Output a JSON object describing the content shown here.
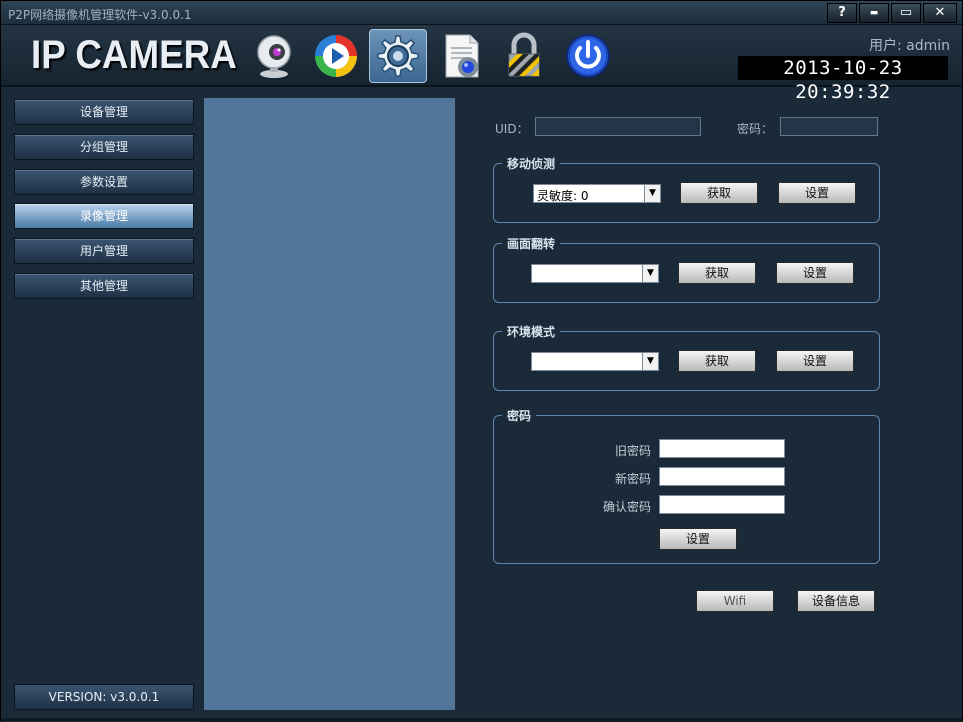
{
  "window": {
    "title": "P2P网络摄像机管理软件-v3.0.0.1",
    "controls": [
      "?",
      "▬",
      "▭",
      "✕"
    ]
  },
  "header": {
    "logo": "IP CAMERA",
    "user": "用户: admin",
    "datetime": "2013-10-23 20:39:32",
    "toolbar": [
      {
        "icon": "webcam-icon"
      },
      {
        "icon": "play-icon"
      },
      {
        "icon": "settings-gear-icon",
        "active": true
      },
      {
        "icon": "document-settings-icon"
      },
      {
        "icon": "lock-icon"
      },
      {
        "icon": "power-icon"
      }
    ]
  },
  "sidebar": {
    "items": [
      {
        "label": "设备管理"
      },
      {
        "label": "分组管理"
      },
      {
        "label": "参数设置"
      },
      {
        "label": "录像管理",
        "selected": true
      },
      {
        "label": "用户管理"
      },
      {
        "label": "其他管理"
      }
    ],
    "version": "VERSION: v3.0.0.1"
  },
  "form": {
    "uid_label": "UID：",
    "uid_value": "",
    "password_label": "密码：",
    "password_value": "",
    "motion": {
      "title": "移动侦测",
      "selected": "灵敏度: 0",
      "get_label": "获取",
      "set_label": "设置"
    },
    "flip": {
      "title": "画面翻转",
      "selected": "",
      "get_label": "获取",
      "set_label": "设置"
    },
    "env": {
      "title": "环境模式",
      "selected": "",
      "get_label": "获取",
      "set_label": "设置"
    },
    "pwd": {
      "title": "密码",
      "old_label": "旧密码",
      "new_label": "新密码",
      "confirm_label": "确认密码",
      "old_value": "",
      "new_value": "",
      "confirm_value": "",
      "set_label": "设置"
    },
    "wifi_label": "Wifi",
    "devinfo_label": "设备信息"
  },
  "colors": {
    "background": "#1a2a38",
    "panel": "#52769a",
    "group_border": "#5f86aa",
    "selected_nav": "#4a7aa6"
  }
}
